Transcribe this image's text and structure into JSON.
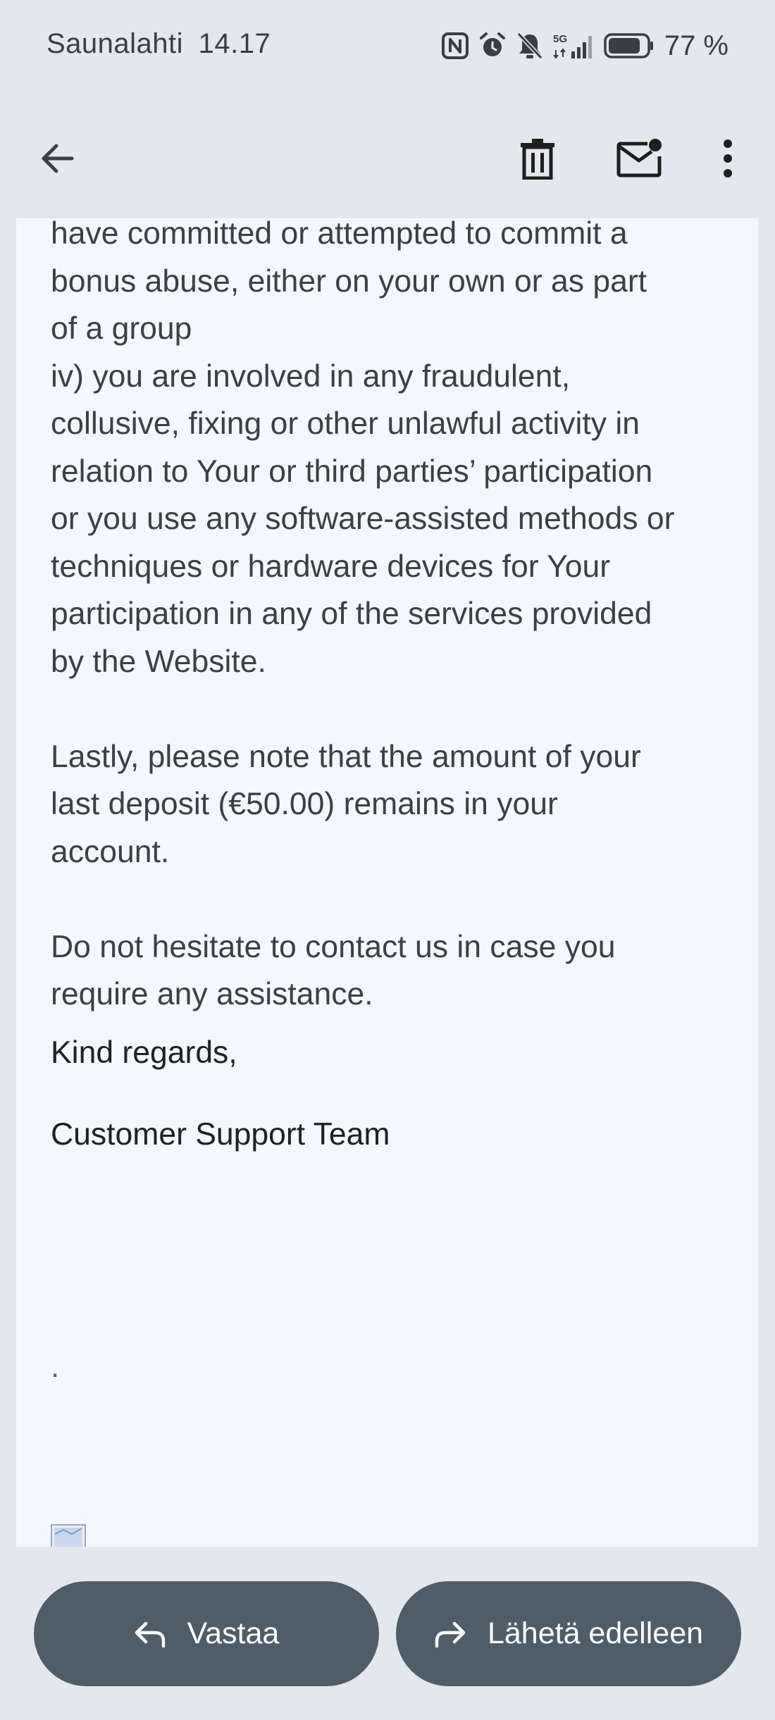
{
  "status_bar": {
    "carrier": "Saunalahti",
    "time": "14.17",
    "network": "5G",
    "battery": "77 %",
    "icons": [
      "nfc-icon",
      "alarm-icon",
      "notifications-off-icon",
      "signal-icon",
      "battery-icon"
    ]
  },
  "toolbar": {
    "icons": [
      "back-arrow-icon",
      "trash-icon",
      "mark-unread-icon",
      "more-vert-icon"
    ]
  },
  "email": {
    "body_lines": [
      "have committed or attempted to commit a",
      "bonus abuse, either on your own or as part",
      "of a group",
      "iv) you are involved in any fraudulent,",
      "collusive, fixing or other unlawful activity in",
      "relation to Your or third parties’ participation",
      "or you use any software-assisted methods or",
      "techniques or hardware devices for Your",
      "participation in any of the services provided",
      "by the Website."
    ],
    "lastly_lines": [
      "Lastly, please note that the amount of your",
      "last deposit (€50.00) remains in your",
      "account."
    ],
    "contact_lines": [
      "Do not hesitate to contact us in case you",
      "require any assistance."
    ],
    "closing": "Kind regards,",
    "signature": "Customer Support Team",
    "trailing_dot": "."
  },
  "actions": {
    "reply_label": "Vastaa",
    "forward_label": "Lähetä edelleen"
  },
  "colors": {
    "background": "#e4e7ed",
    "card": "#f4f7fc",
    "button": "#4f5d69",
    "button_text": "#ffffff",
    "text": "#3c4043"
  }
}
